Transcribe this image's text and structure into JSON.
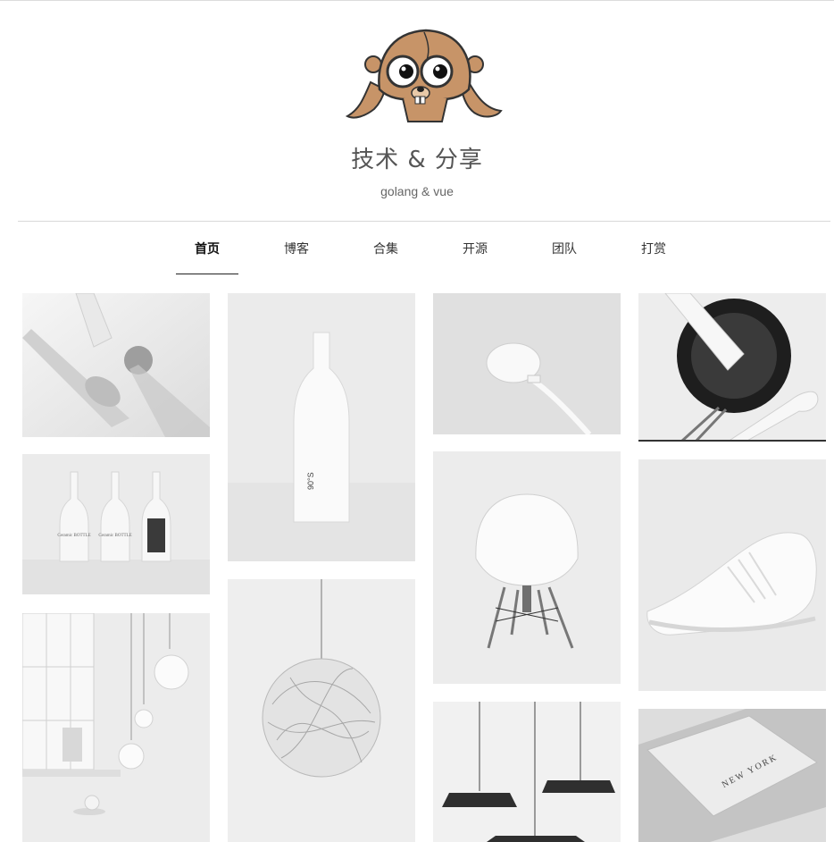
{
  "site": {
    "title": "技术 & 分享",
    "subtitle": "golang & vue",
    "logo_icon": "gopher-aviator-logo"
  },
  "nav": {
    "items": [
      {
        "label": "首页",
        "active": true
      },
      {
        "label": "博客",
        "active": false
      },
      {
        "label": "合集",
        "active": false
      },
      {
        "label": "开源",
        "active": false
      },
      {
        "label": "团队",
        "active": false
      },
      {
        "label": "打赏",
        "active": false
      }
    ]
  },
  "gallery": {
    "items": [
      {
        "subject": "geometric shapes still life"
      },
      {
        "subject": "ceramic bottles trio",
        "bottle_label": "Ceramic BOTTLE"
      },
      {
        "subject": "pendant bulbs interior"
      },
      {
        "subject": "white bottle",
        "bottle_label": "90°S"
      },
      {
        "subject": "wire pendant lamp"
      },
      {
        "subject": "wireless charger"
      },
      {
        "subject": "white shell chair"
      },
      {
        "subject": "black pendant lamps"
      },
      {
        "subject": "black pan and spatula"
      },
      {
        "subject": "white sneaker"
      },
      {
        "subject": "notebook",
        "book_label": "NEW YORK"
      }
    ]
  },
  "colors": {
    "gopher_brown": "#c79468",
    "nav_text": "#333333",
    "title_text": "#555555"
  }
}
